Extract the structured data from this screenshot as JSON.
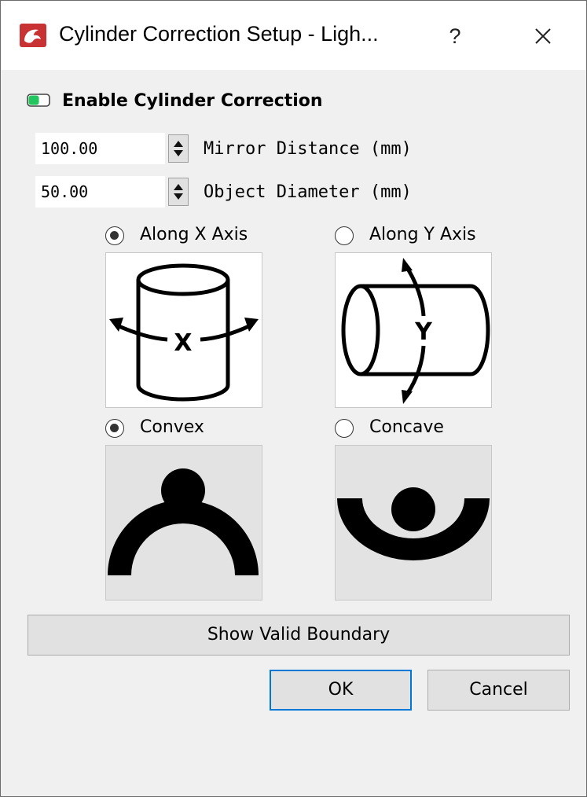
{
  "window": {
    "title": "Cylinder Correction Setup - Ligh...",
    "help_label": "?",
    "close_icon": "close-icon",
    "app_icon": "lightburn-logo-icon"
  },
  "enable": {
    "label": "Enable Cylinder Correction",
    "checked": true,
    "on_color": "#22c55e"
  },
  "fields": [
    {
      "value": "100.00",
      "label": "Mirror Distance (mm)"
    },
    {
      "value": "50.00",
      "label": "Object Diameter (mm)"
    }
  ],
  "axis": {
    "x_label": "Along X Axis",
    "y_label": "Along Y Axis",
    "selected": "x",
    "x_glyph": "X",
    "y_glyph": "Y"
  },
  "shape": {
    "convex_label": "Convex",
    "concave_label": "Concave",
    "selected": "convex"
  },
  "buttons": {
    "show_boundary": "Show Valid Boundary",
    "ok": "OK",
    "cancel": "Cancel"
  }
}
